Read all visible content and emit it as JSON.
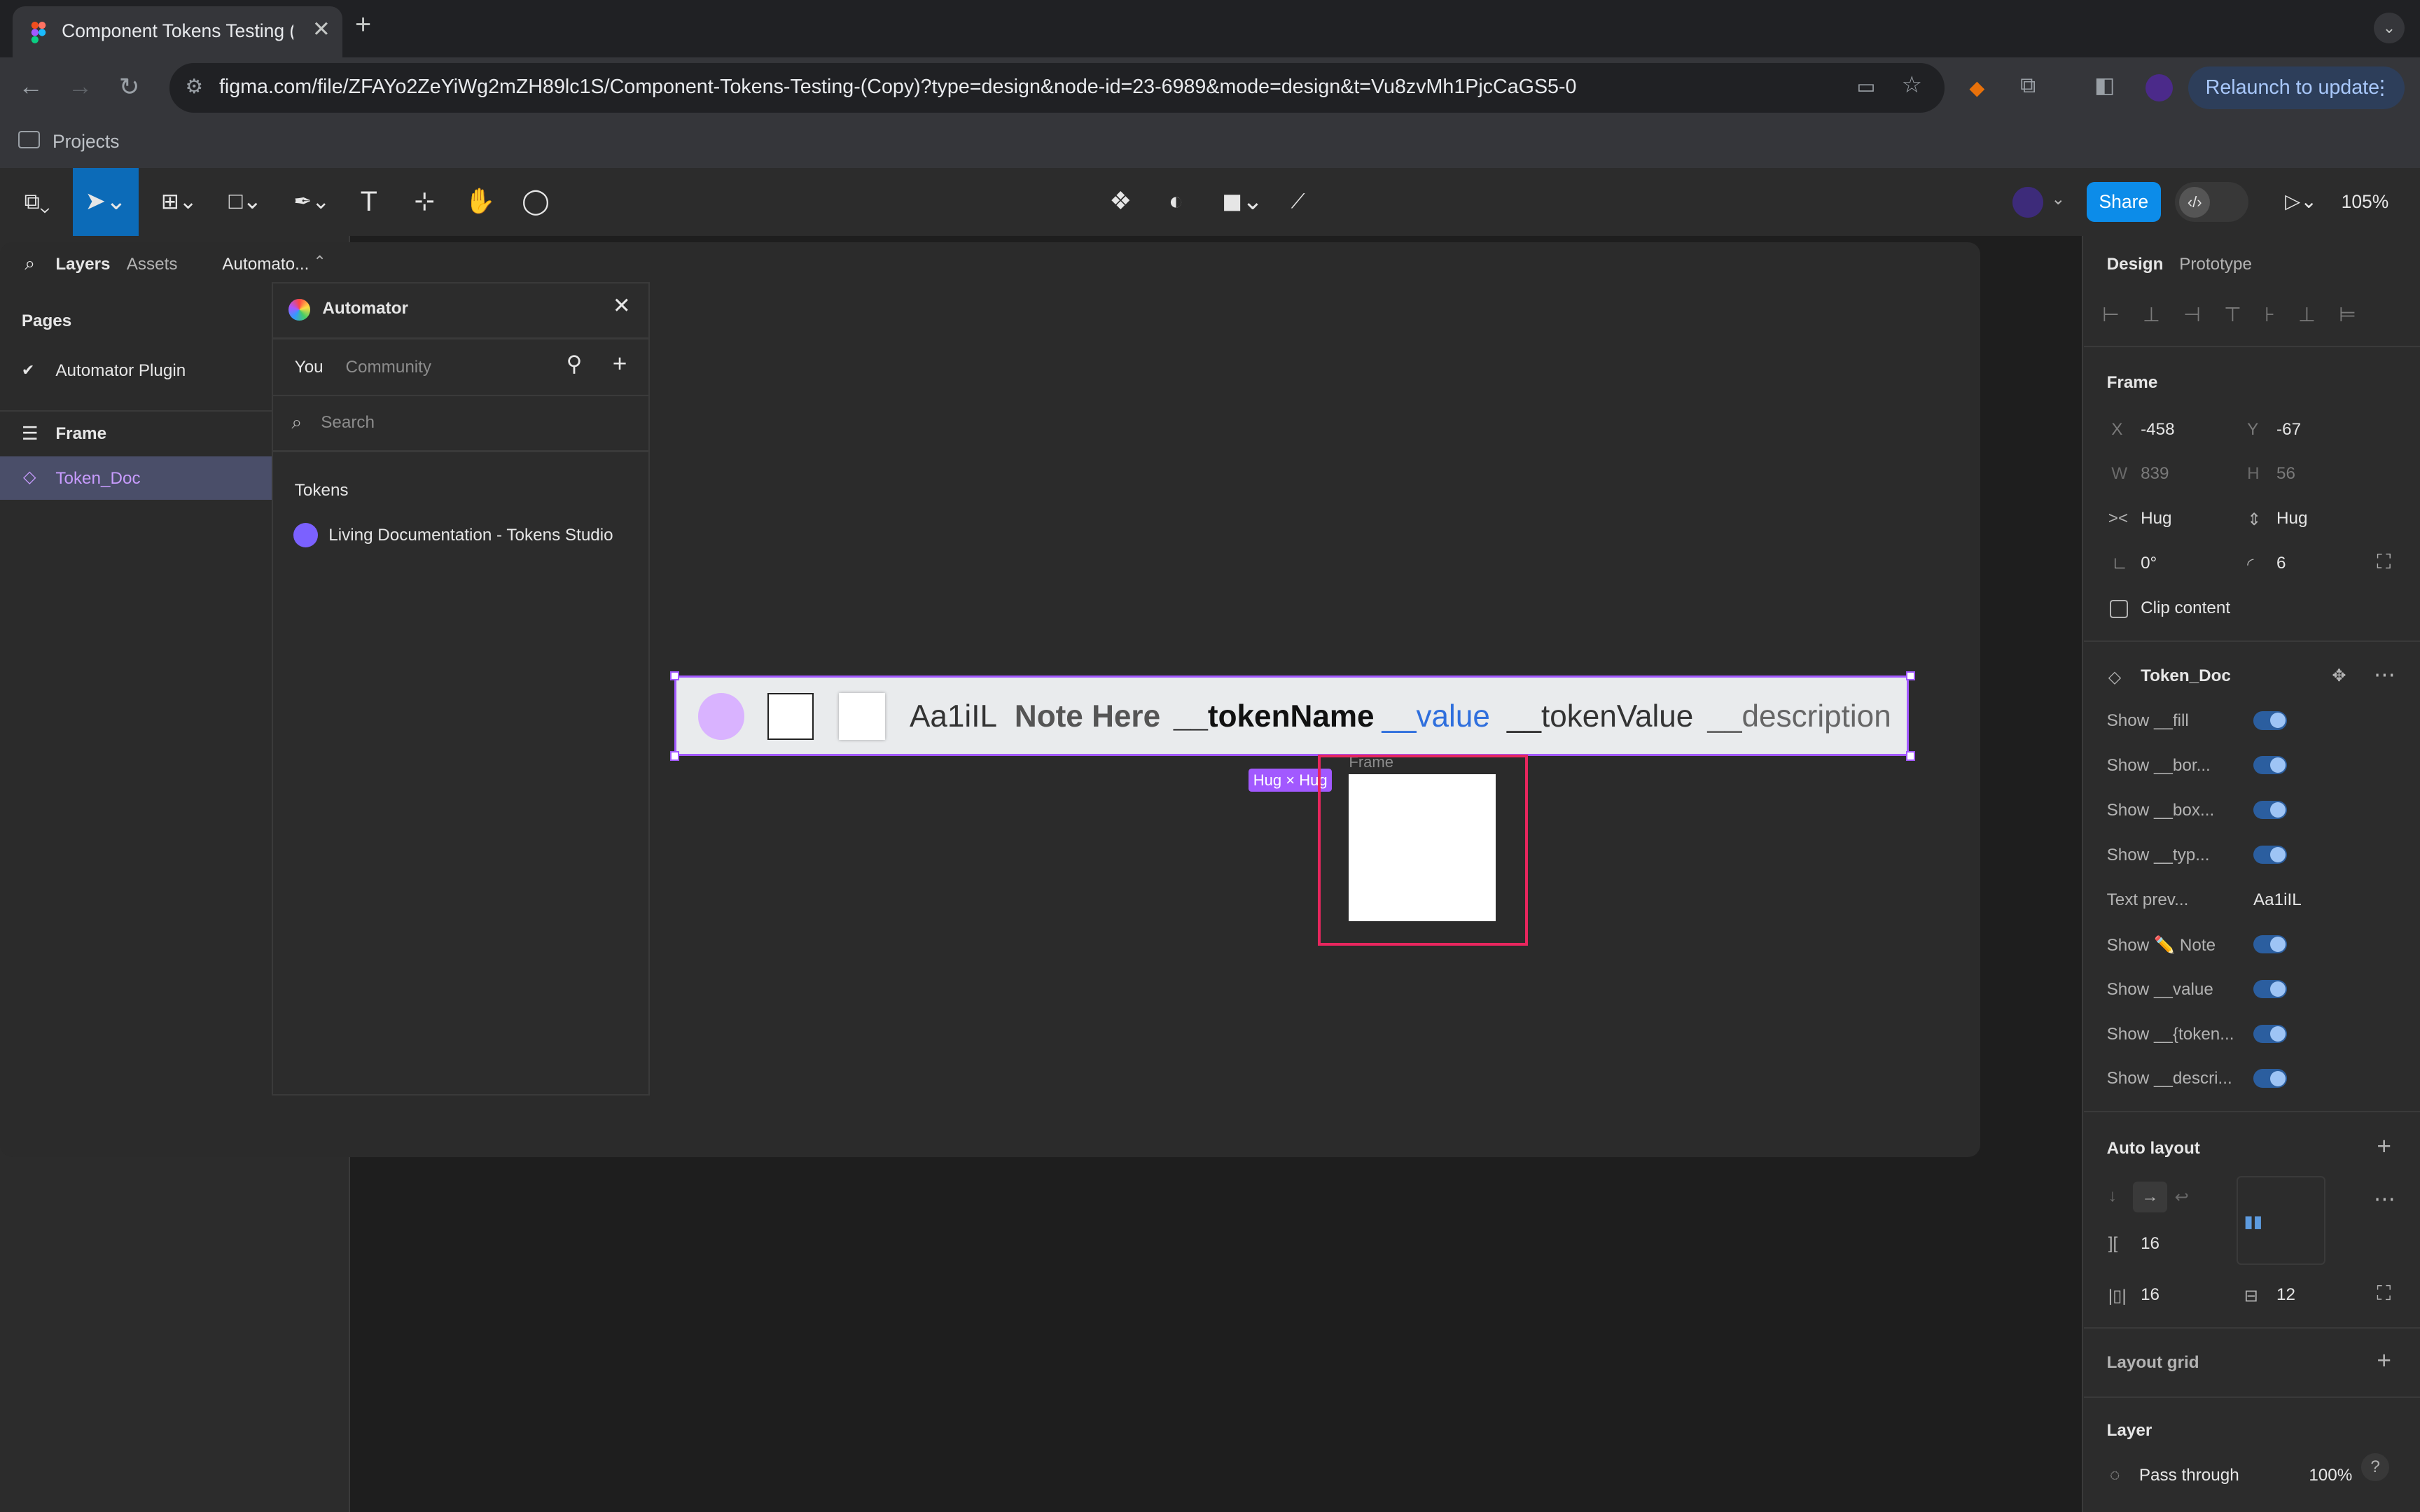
{
  "browser": {
    "tab_title": "Component Tokens Testing (C",
    "url": "figma.com/file/ZFAYo2ZeYiWg2mZH89lc1S/Component-Tokens-Testing-(Copy)?type=design&node-id=23-6989&mode=design&t=Vu8zvMh1PjcCaGS5-0",
    "relaunch_label": "Relaunch to update",
    "bookmark": "Projects"
  },
  "toolbar": {
    "share_label": "Share",
    "zoom": "105%"
  },
  "left_panel": {
    "tabs": [
      "Layers",
      "Assets",
      "Automato..."
    ],
    "pages_heading": "Pages",
    "current_page": "Automator Plugin",
    "layers": [
      "Frame",
      "Token_Doc"
    ]
  },
  "plugin": {
    "title": "Automator",
    "tabs": [
      "You",
      "Community"
    ],
    "search_placeholder": "Search",
    "section": "Tokens",
    "item": "Living Documentation - Tokens Studio"
  },
  "canvas": {
    "sample_text": "Aa1iIL",
    "note": "Note Here",
    "token_name": "__tokenName",
    "value": "__value",
    "token_value": "__tokenValue",
    "description": "__description",
    "hug_badge": "Hug × Hug",
    "frame_label": "Frame"
  },
  "right_panel": {
    "tabs": [
      "Design",
      "Prototype"
    ],
    "frame_heading": "Frame",
    "x_label": "X",
    "x": "-458",
    "y_label": "Y",
    "y": "-67",
    "w_label": "W",
    "w": "839",
    "h_label": "H",
    "h": "56",
    "hug_w": "Hug",
    "hug_h": "Hug",
    "rotation": "0°",
    "radius": "6",
    "clip_content": "Clip content",
    "component": "Token_Doc",
    "props": [
      {
        "label": "Show __fill",
        "toggle": true
      },
      {
        "label": "Show __bor...",
        "toggle": true
      },
      {
        "label": "Show __box...",
        "toggle": true
      },
      {
        "label": "Show __typ...",
        "toggle": true
      },
      {
        "label": "Text prev...",
        "value": "Aa1iIL"
      },
      {
        "label": "Show ✏️ Note",
        "toggle": true
      },
      {
        "label": "Show __value",
        "toggle": true
      },
      {
        "label": "Show __{token...",
        "toggle": true
      },
      {
        "label": "Show __descri...",
        "toggle": true
      }
    ],
    "auto_layout": "Auto layout",
    "gap": "16",
    "pad_h": "16",
    "pad_v": "12",
    "layout_grid": "Layout grid",
    "layer": "Layer",
    "blend": "Pass through",
    "opacity": "100%"
  }
}
